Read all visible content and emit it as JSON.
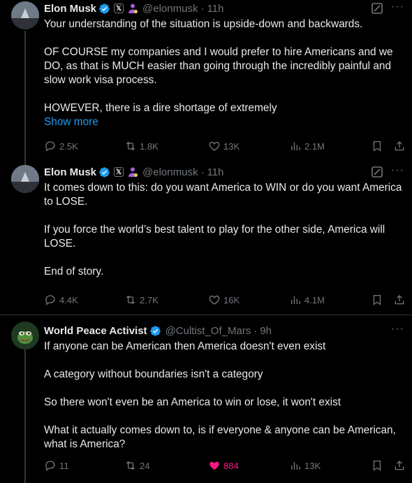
{
  "tweets": [
    {
      "name": "Elon Musk",
      "handle": "@elonmusk",
      "dot": "·",
      "time": "11h",
      "paragraphs": [
        "Your understanding of the situation is upside-down and backwards.",
        "OF COURSE my companies and I would prefer to hire Americans and we DO, as that is MUCH easier than going through the incredibly painful and slow work visa process.",
        "HOWEVER, there is a dire shortage of extremely"
      ],
      "show_more": "Show more",
      "replies": "2.5K",
      "reposts": "1.8K",
      "likes": "13K",
      "views": "2.1M"
    },
    {
      "name": "Elon Musk",
      "handle": "@elonmusk",
      "dot": "·",
      "time": "11h",
      "paragraphs": [
        "It comes down to this: do you want America to WIN or do you want America to LOSE.",
        "If you force the world’s best talent to play for the other side, America will LOSE.",
        "End of story."
      ],
      "replies": "4.4K",
      "reposts": "2.7K",
      "likes": "16K",
      "views": "4.1M"
    },
    {
      "name": "World Peace Activist",
      "handle": "@Cultist_Of_Mars",
      "dot": "·",
      "time": "9h",
      "paragraphs": [
        "If anyone can be American then America doesn't even exist",
        "A category without boundaries isn't a category",
        "So there won't even be an America to win or lose, it won't exist",
        "What it actually comes down to, is if everyone & anyone can be American, what is America?"
      ],
      "replies": "11",
      "reposts": "24",
      "likes": "884",
      "views": "13K"
    }
  ],
  "badges": {
    "x": "𝕏",
    "more": "···"
  },
  "colors": {
    "accent": "#1d9bf0",
    "like": "#f91880",
    "muted": "#71767b",
    "verified": "#1d9bf0",
    "affiliate": "#a95be0"
  }
}
